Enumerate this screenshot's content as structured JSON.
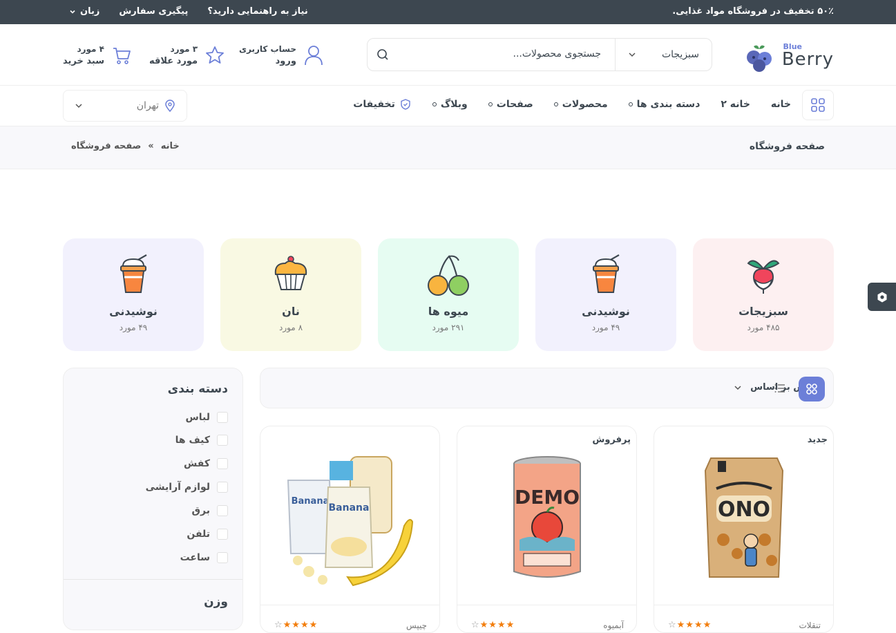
{
  "topbar": {
    "promo": "۵۰٪ تخفیف در فروشگاه مواد غذایی.",
    "help": "نیاز به راهنمایی دارید؟",
    "track": "پیگیری سفارش",
    "lang": "زبان"
  },
  "header": {
    "logo_small": "Blue",
    "logo_big": "Berry",
    "search_category": "سبزیجات",
    "search_placeholder": "جستجوی محصولات...",
    "account_top": "حساب کاربری",
    "account_bottom": "ورود",
    "wishlist_top": "۳ مورد",
    "wishlist_bottom": "مورد علاقه",
    "cart_top": "۴ مورد",
    "cart_bottom": "سبد خرید"
  },
  "nav": {
    "items": [
      "خانه",
      "خانه ۲",
      "دسته بندی ها",
      "محصولات",
      "صفحات",
      "وبلاگ",
      "تخفیفات"
    ],
    "location": "تهران"
  },
  "breadcrumb": {
    "title": "صفحه فروشگاه",
    "home": "خانه",
    "sep": "»",
    "current": "صفحه فروشگاه"
  },
  "categories": [
    {
      "name": "سبزیجات",
      "count": "۴۸۵ مورد",
      "bg": "#fdf0f1",
      "icon": "radish-icon"
    },
    {
      "name": "نوشیدنی",
      "count": "۴۹ مورد",
      "bg": "#f2f1fd",
      "icon": "drink-icon"
    },
    {
      "name": "میوه ها",
      "count": "۲۹۱ مورد",
      "bg": "#e6fcf2",
      "icon": "cherry-icon"
    },
    {
      "name": "نان",
      "count": "۸ مورد",
      "bg": "#f9f9e3",
      "icon": "cupcake-icon"
    },
    {
      "name": "نوشیدنی",
      "count": "۴۹ مورد",
      "bg": "#f2f1fd",
      "icon": "drink-icon"
    }
  ],
  "sidebar": {
    "category_title": "دسته بندی",
    "items": [
      "لباس",
      "کیف ها",
      "کفش",
      "لوازم آرایشی",
      "برق",
      "تلفن",
      "ساعت"
    ],
    "weight_title": "وزن"
  },
  "sort": {
    "label": "نمایش بر اساس"
  },
  "products": [
    {
      "tag": "جدید",
      "category": "تنقلات",
      "rating": 4,
      "brand_text": "ONO",
      "image": "groundnut-snack-bag"
    },
    {
      "tag": "پرفروش",
      "category": "آبمیوه",
      "rating": 4,
      "brand_text": "DEMO",
      "image": "juice-can"
    },
    {
      "tag": "",
      "category": "چیپس",
      "rating": 4,
      "brand_text": "Banana",
      "image": "banana-snack-pack"
    }
  ],
  "colors": {
    "accent": "#6c7fd8",
    "dark": "#3d4750",
    "star": "#f27d0c"
  }
}
